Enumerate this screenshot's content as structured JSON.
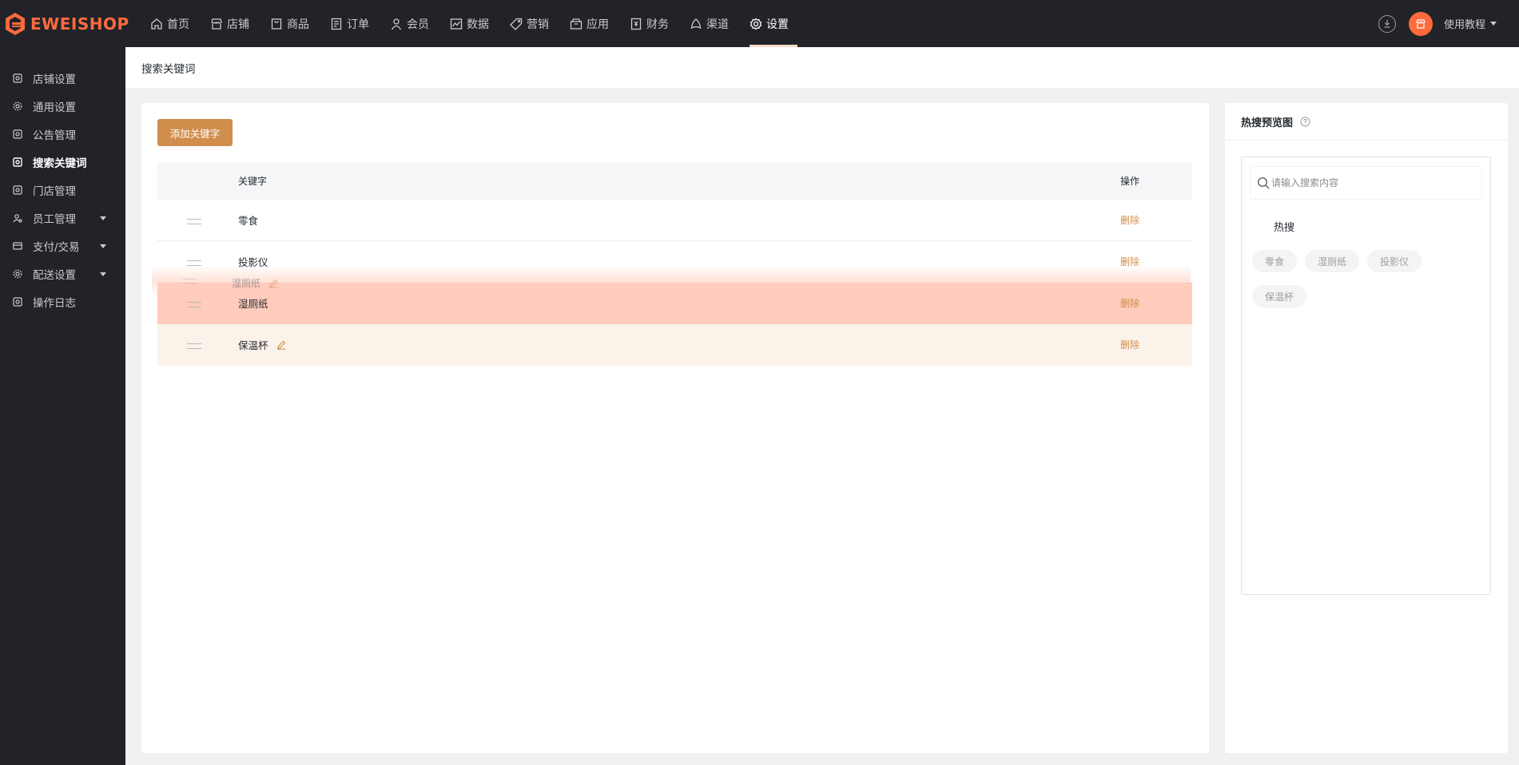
{
  "brand": {
    "name": "EWEISHOP",
    "color": "#ff6a3d"
  },
  "topnav": {
    "items": [
      {
        "label": "首页",
        "icon": "home-icon"
      },
      {
        "label": "店铺",
        "icon": "store-icon"
      },
      {
        "label": "商品",
        "icon": "goods-icon"
      },
      {
        "label": "订单",
        "icon": "order-icon"
      },
      {
        "label": "会员",
        "icon": "member-icon"
      },
      {
        "label": "数据",
        "icon": "chart-icon"
      },
      {
        "label": "营销",
        "icon": "tag-icon"
      },
      {
        "label": "应用",
        "icon": "app-icon"
      },
      {
        "label": "财务",
        "icon": "finance-icon"
      },
      {
        "label": "渠道",
        "icon": "channel-icon"
      },
      {
        "label": "设置",
        "icon": "gear-icon",
        "active": true
      }
    ],
    "tutorial_label": "使用教程"
  },
  "sidebar": {
    "items": [
      {
        "label": "店铺设置"
      },
      {
        "label": "通用设置"
      },
      {
        "label": "公告管理"
      },
      {
        "label": "搜索关键词",
        "active": true
      },
      {
        "label": "门店管理"
      },
      {
        "label": "员工管理",
        "expandable": true
      },
      {
        "label": "支付/交易",
        "expandable": true
      },
      {
        "label": "配送设置",
        "expandable": true
      },
      {
        "label": "操作日志"
      }
    ]
  },
  "page": {
    "title": "搜索关键词",
    "add_button": "添加关键字"
  },
  "table": {
    "headers": {
      "keyword": "关键字",
      "operation": "操作"
    },
    "rows": [
      {
        "keyword": "零食",
        "action": "删除"
      },
      {
        "keyword": "投影仪",
        "action": "删除"
      },
      {
        "keyword": "湿厕纸",
        "action": "删除"
      },
      {
        "keyword": "保温杯",
        "action": "删除"
      }
    ],
    "drag_ghost_label": "湿厕纸"
  },
  "preview": {
    "title": "热搜预览图",
    "search_placeholder": "请输入搜索内容",
    "hot_title": "热搜",
    "tags": [
      "零食",
      "湿厕纸",
      "投影仪",
      "保温杯"
    ]
  },
  "colors": {
    "topbar_bg": "#212329",
    "accent": "#d08d4c",
    "highlight_row": "#ffcbbc",
    "drag_row": "#fbf2ea"
  }
}
